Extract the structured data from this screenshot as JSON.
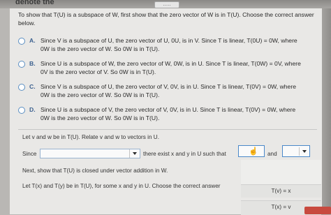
{
  "header": {
    "cut_text": "denote the",
    "handle_label": "....."
  },
  "question": "To show that T(U) is a subspace of W, first show that the zero vector of W is in T(U). Choose the correct answer below.",
  "options": [
    {
      "letter": "A.",
      "line1": "Since V is a subspace of U, the zero vector of U, 0U, is in V. Since T is linear, T(0U) = 0W, where",
      "line2": "0W is the zero vector of W. So 0W is in T(U)."
    },
    {
      "letter": "B.",
      "line1": "Since U is a subspace of W, the zero vector of W, 0W, is in U. Since T is linear, T(0W) = 0V, where",
      "line2": "0V is the zero vector of V. So 0W is in T(U)."
    },
    {
      "letter": "C.",
      "line1": "Since V is a subspace of U, the zero vector of V, 0V, is in U. Since T is linear, T(0V) = 0W, where",
      "line2": "0W is the zero vector of W. So 0W is in T(U)."
    },
    {
      "letter": "D.",
      "line1": "Since U is a subspace of V, the zero vector of V, 0V, is in U. Since T is linear, T(0V) = 0W, where",
      "line2": "0W is the zero vector of W. So 0W is in T(U)."
    }
  ],
  "relate_line": "Let v and w be in T(U). Relate v and w to vectors in U.",
  "since_label": "Since",
  "there_exist": "there exist x and y in U such that",
  "and_label": "and",
  "closure_line": "Next, show that T(U) is closed under vector addition in W.",
  "let_line": "Let T(x) and T(y) be in T(U), for some x and y in U. Choose the correct answer",
  "tv_options": [
    "T(v) = x",
    "T(x) = v"
  ]
}
